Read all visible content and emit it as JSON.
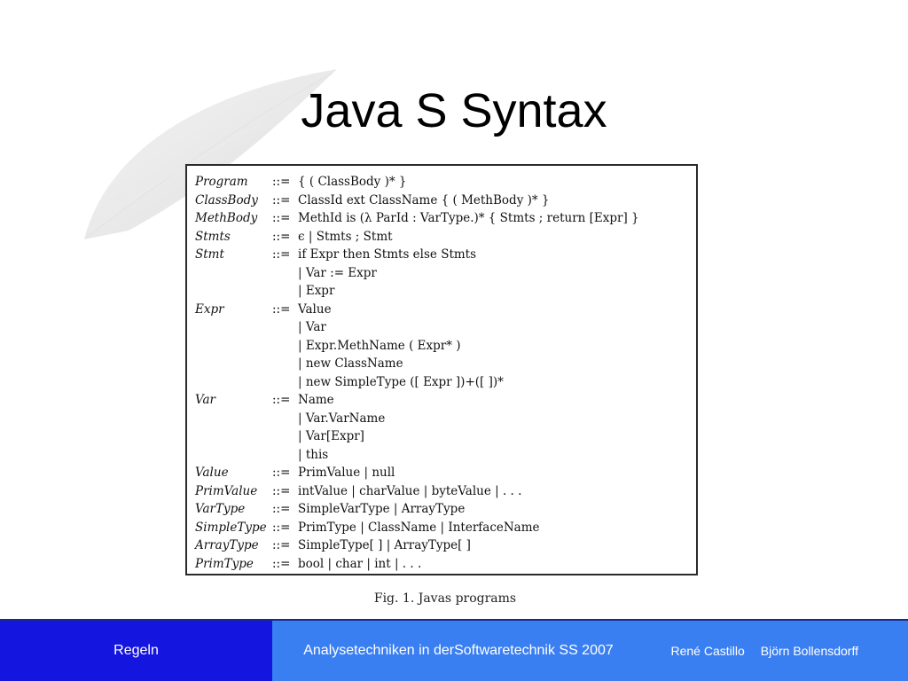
{
  "title": "Java S Syntax",
  "grammar": [
    {
      "lhs": "Program",
      "op": "::=",
      "rhs": "{ ( ClassBody )* }"
    },
    {
      "lhs": "ClassBody",
      "op": "::=",
      "rhs": "ClassId ext ClassName { ( MethBody )* }"
    },
    {
      "lhs": "MethBody",
      "op": "::=",
      "rhs": "MethId is (λ ParId : VarType.)* { Stmts ; return [Expr] }"
    },
    {
      "lhs": "Stmts",
      "op": "::=",
      "rhs": "ϵ | Stmts ; Stmt"
    },
    {
      "lhs": "Stmt",
      "op": "::=",
      "rhs": "if Expr then Stmts else Stmts"
    },
    {
      "lhs": "",
      "op": "",
      "rhs": "| Var := Expr"
    },
    {
      "lhs": "",
      "op": "",
      "rhs": "| Expr"
    },
    {
      "lhs": "Expr",
      "op": "::=",
      "rhs": "Value"
    },
    {
      "lhs": "",
      "op": "",
      "rhs": "| Var"
    },
    {
      "lhs": "",
      "op": "",
      "rhs": "| Expr.MethName ( Expr* )"
    },
    {
      "lhs": "",
      "op": "",
      "rhs": "| new ClassName"
    },
    {
      "lhs": "",
      "op": "",
      "rhs": "| new SimpleType ([ Expr ])+([ ])*"
    },
    {
      "lhs": "Var",
      "op": "::=",
      "rhs": "Name"
    },
    {
      "lhs": "",
      "op": "",
      "rhs": "| Var.VarName"
    },
    {
      "lhs": "",
      "op": "",
      "rhs": "| Var[Expr]"
    },
    {
      "lhs": "",
      "op": "",
      "rhs": "| this"
    },
    {
      "lhs": "Value",
      "op": "::=",
      "rhs": "PrimValue | null"
    },
    {
      "lhs": "PrimValue",
      "op": "::=",
      "rhs": "intValue | charValue | byteValue | . . ."
    },
    {
      "lhs": "VarType",
      "op": "::=",
      "rhs": "SimpleVarType | ArrayType"
    },
    {
      "lhs": "SimpleType",
      "op": "::=",
      "rhs": "PrimType | ClassName | InterfaceName"
    },
    {
      "lhs": "ArrayType",
      "op": "::=",
      "rhs": "SimpleType[ ] | ArrayType[ ]"
    },
    {
      "lhs": "PrimType",
      "op": "::=",
      "rhs": "bool | char | int | . . ."
    }
  ],
  "caption": "Fig. 1. Javas programs",
  "footer": {
    "left": "Regeln",
    "mid_line1": "Analysetechniken in der",
    "mid_line2": "Softwaretechnik SS 2007",
    "author1": "René Castillo",
    "author2": "Björn Bollensdorff"
  },
  "colors": {
    "footer_left_bg": "#1515e0",
    "footer_right_bg": "#3a7ff2"
  }
}
